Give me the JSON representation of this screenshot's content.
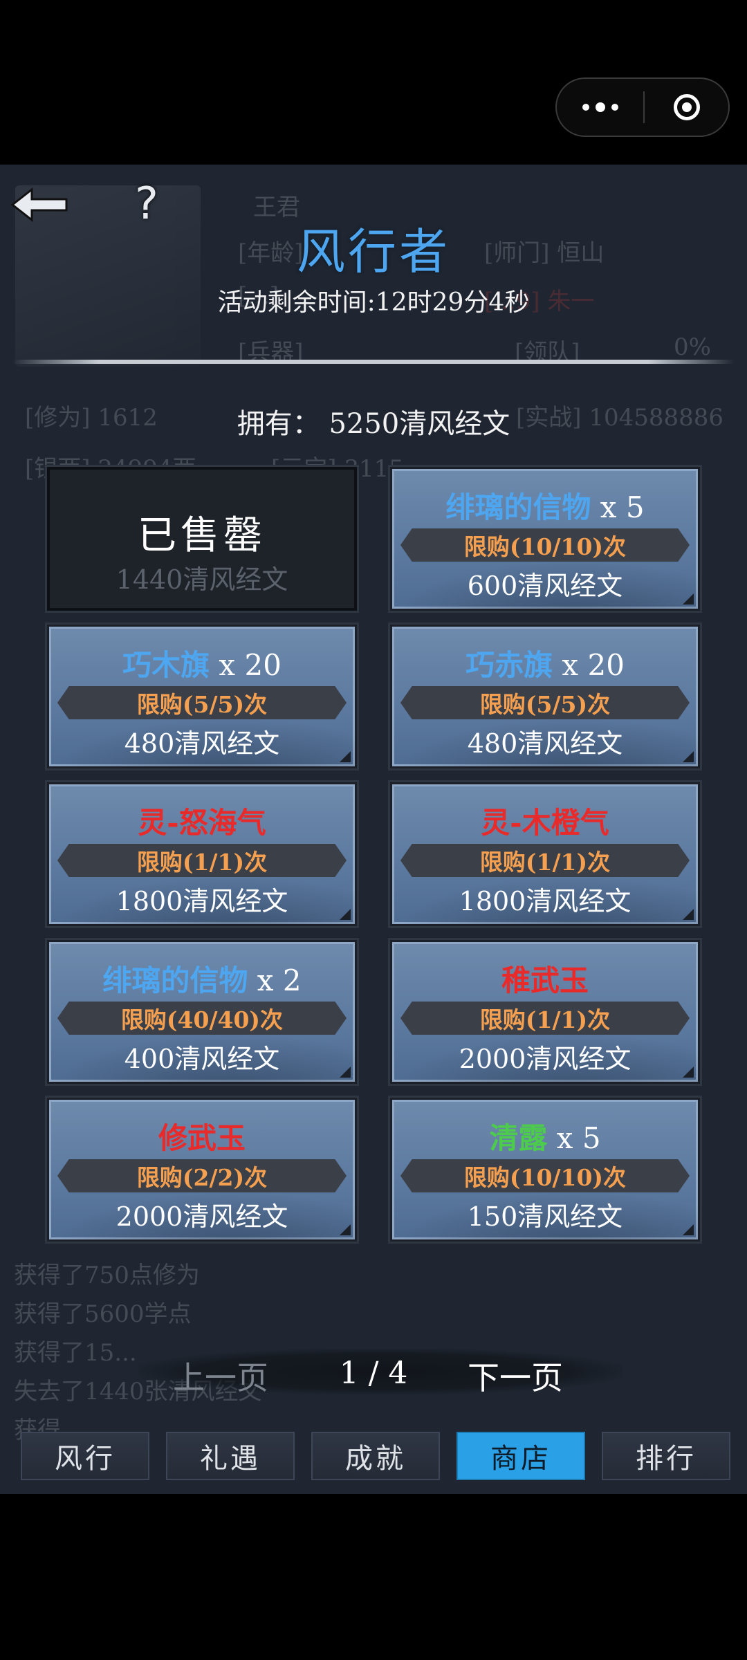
{
  "capsule": {
    "more_icon": "more-dots-icon",
    "close_icon": "target-circle-icon"
  },
  "header": {
    "title": "风行者",
    "countdown": "活动剩余时间:12时29分4秒",
    "help_icon": "?",
    "back_icon": "back-arrow-icon"
  },
  "background": {
    "name": "王君",
    "age_label": "[年龄]",
    "school": "[师门]  恒山",
    "row2_label": "[...]",
    "row2_value": "[...9]   朱一",
    "weapon_label": "[兵器]",
    "team": "[领队]",
    "team_pct": "0%",
    "cultivation": "[修为] 1612",
    "combat": "[实战]  104588886",
    "silver": "[银两] 24994两",
    "yuanbao": "[元宝] 3115",
    "log": [
      "获得了750点修为",
      "获得了5600学点",
      "获得了15...",
      "失去了1440张清风经文",
      "获得..."
    ]
  },
  "owned": "拥有： 5250清风经文",
  "shop": {
    "sold_out": {
      "label": "已售罄",
      "price": "1440清风经文"
    },
    "items": [
      {
        "name": "绯璃的信物",
        "qty": " x 5",
        "limit": "限购(10/10)次",
        "price": "600清风经文",
        "color": "blue"
      },
      {
        "name": "巧木旗",
        "qty": " x 20",
        "limit": "限购(5/5)次",
        "price": "480清风经文",
        "color": "blue"
      },
      {
        "name": "巧赤旗",
        "qty": " x 20",
        "limit": "限购(5/5)次",
        "price": "480清风经文",
        "color": "blue"
      },
      {
        "name": "灵-怒海气",
        "qty": "",
        "limit": "限购(1/1)次",
        "price": "1800清风经文",
        "color": "red"
      },
      {
        "name": "灵-木橙气",
        "qty": "",
        "limit": "限购(1/1)次",
        "price": "1800清风经文",
        "color": "red"
      },
      {
        "name": "绯璃的信物",
        "qty": " x 2",
        "limit": "限购(40/40)次",
        "price": "400清风经文",
        "color": "blue"
      },
      {
        "name": "稚武玉",
        "qty": "",
        "limit": "限购(1/1)次",
        "price": "2000清风经文",
        "color": "red"
      },
      {
        "name": "修武玉",
        "qty": "",
        "limit": "限购(2/2)次",
        "price": "2000清风经文",
        "color": "red"
      },
      {
        "name": "清露",
        "qty": " x 5",
        "limit": "限购(10/10)次",
        "price": "150清风经文",
        "color": "green"
      }
    ]
  },
  "pager": {
    "prev": "上一页",
    "page": "1 / 4",
    "next": "下一页"
  },
  "tabs": [
    {
      "label": "风行",
      "active": false
    },
    {
      "label": "礼遇",
      "active": false
    },
    {
      "label": "成就",
      "active": false
    },
    {
      "label": "商店",
      "active": true
    },
    {
      "label": "排行",
      "active": false
    }
  ],
  "colors": {
    "accent": "#2aa0e6",
    "title": "#4da6ef",
    "limit": "#f5a050",
    "rare": "#e82a2a",
    "green": "#4ccb4c"
  }
}
